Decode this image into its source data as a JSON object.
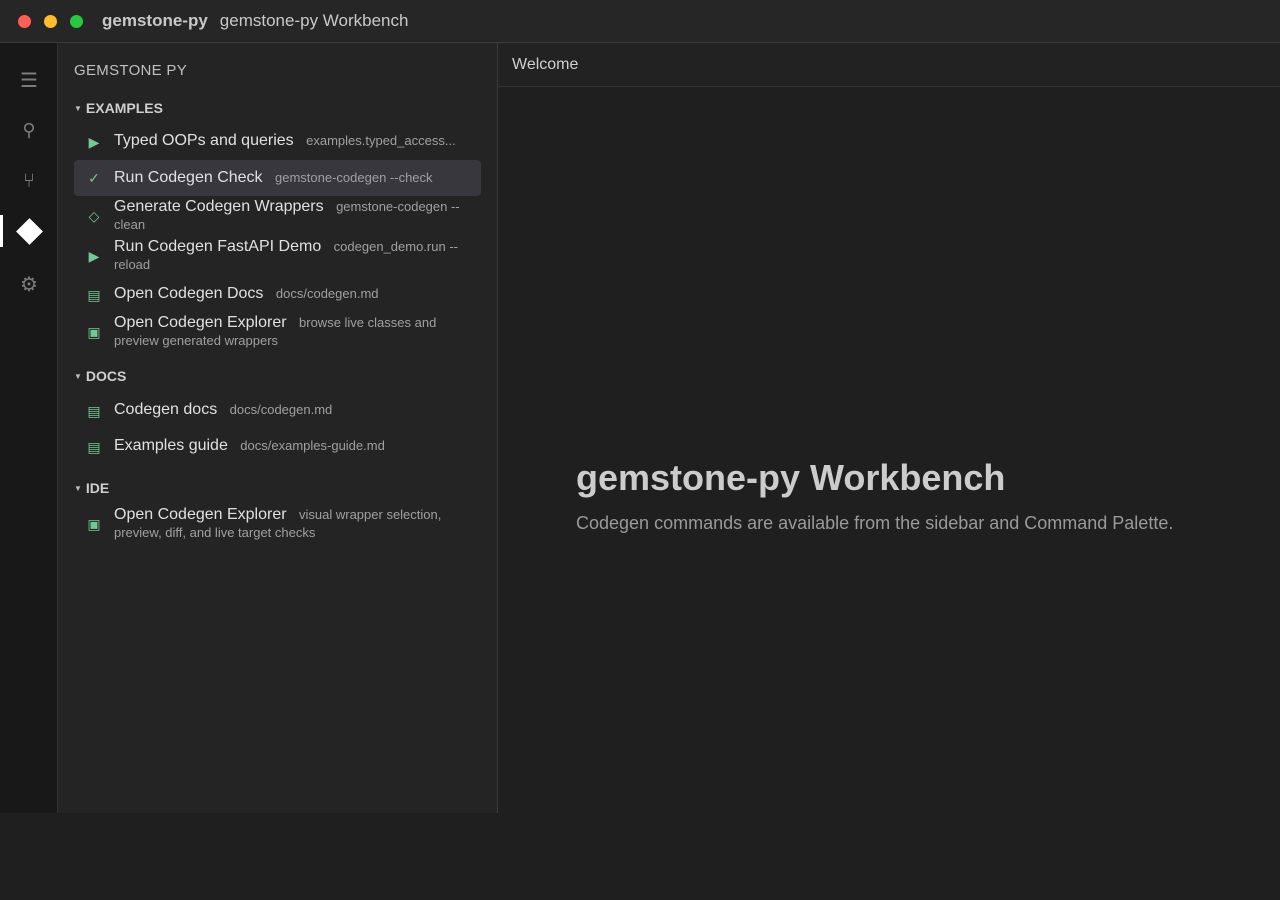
{
  "window": {
    "app_name": "gemstone-py",
    "title": "gemstone-py Workbench"
  },
  "activity_bar": {
    "items": [
      {
        "name": "menu",
        "glyph": "☰"
      },
      {
        "name": "search",
        "glyph": "⚲"
      },
      {
        "name": "source-control",
        "glyph": "⑂"
      },
      {
        "name": "gemstone",
        "glyph": ""
      },
      {
        "name": "settings",
        "glyph": "⚙"
      }
    ]
  },
  "sidebar": {
    "title": "GEMSTONE PY",
    "sections": [
      {
        "label": "EXAMPLES",
        "items": [
          {
            "icon": "play-icon",
            "glyph": "▶",
            "label": "Typed OOPs and queries",
            "desc": "examples.typed_access..."
          },
          {
            "icon": "check-icon",
            "glyph": "✓",
            "label": "Run Codegen Check",
            "desc": "gemstone-codegen --check",
            "selected": true
          },
          {
            "icon": "diamond-outline-icon",
            "glyph": "◇",
            "label": "Generate Codegen Wrappers",
            "desc": "gemstone-codegen --clean"
          },
          {
            "icon": "play-icon",
            "glyph": "▶",
            "label": "Run Codegen FastAPI Demo",
            "desc": "codegen_demo.run --reload"
          },
          {
            "icon": "document-icon",
            "glyph": "▤",
            "label": "Open Codegen Docs",
            "desc": "docs/codegen.md"
          },
          {
            "icon": "explorer-icon",
            "glyph": "▣",
            "label": "Open Codegen Explorer",
            "desc": "browse live classes and preview generated wrappers"
          }
        ]
      },
      {
        "label": "DOCS",
        "items": [
          {
            "icon": "document-icon",
            "glyph": "▤",
            "label": "Codegen docs",
            "desc": "docs/codegen.md"
          },
          {
            "icon": "document-icon",
            "glyph": "▤",
            "label": "Examples guide",
            "desc": "docs/examples-guide.md"
          }
        ]
      },
      {
        "label": "IDE",
        "items": [
          {
            "icon": "explorer-icon",
            "glyph": "▣",
            "label": "Open Codegen Explorer",
            "desc": "visual wrapper selection, preview, diff, and live target checks"
          }
        ]
      }
    ]
  },
  "editor": {
    "tab_label": "Welcome",
    "heading": "gemstone-py Workbench",
    "subheading": "Codegen commands are available from the sidebar and Command Palette."
  },
  "colors": {
    "accent_green": "#73c991",
    "selection": "#37373d"
  }
}
